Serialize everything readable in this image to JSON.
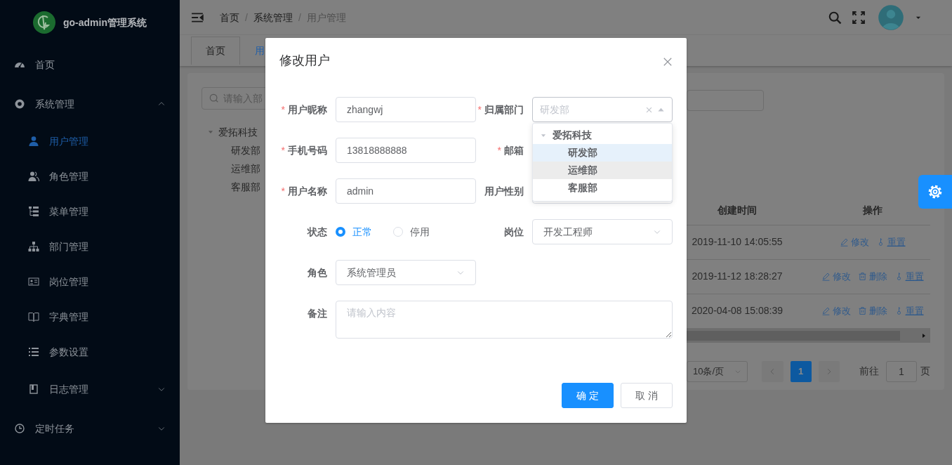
{
  "sidebar": {
    "logo_text": "go-admin管理系统",
    "items": [
      {
        "label": "首页",
        "selected": false
      },
      {
        "label": "系统管理",
        "selected": false,
        "expanded": true,
        "children": [
          {
            "label": "用户管理",
            "selected": true
          },
          {
            "label": "角色管理",
            "selected": false
          },
          {
            "label": "菜单管理",
            "selected": false
          },
          {
            "label": "部门管理",
            "selected": false
          },
          {
            "label": "岗位管理",
            "selected": false
          },
          {
            "label": "字典管理",
            "selected": false
          },
          {
            "label": "参数设置",
            "selected": false
          },
          {
            "label": "日志管理",
            "selected": false,
            "expanded": false
          }
        ]
      },
      {
        "label": "定时任务",
        "selected": false,
        "expanded": false
      }
    ]
  },
  "breadcrumb": [
    {
      "label": "首页",
      "current": false
    },
    {
      "separator": "/",
      "label": "系统管理",
      "current": false
    },
    {
      "separator": "/",
      "label": "用户管理",
      "current": true
    }
  ],
  "tabs": [
    {
      "label": "首页",
      "selected": false
    },
    {
      "label": "用",
      "selected": true
    }
  ],
  "dept_panel": {
    "search_placeholder": "请输入部",
    "tree": [
      {
        "label": "爱拓科技",
        "expanded": true,
        "children": [
          {
            "label": "研发部"
          },
          {
            "label": "运维部"
          },
          {
            "label": "客服部"
          }
        ]
      }
    ]
  },
  "table": {
    "columns": [
      "创建时间",
      "操作"
    ],
    "rows": [
      {
        "created": "2019-11-10 14:05:55",
        "actions": [
          {
            "kind": "edit",
            "label": "修改"
          },
          {
            "kind": "reset",
            "label": "重置"
          }
        ]
      },
      {
        "created": "2019-11-12 18:28:27",
        "actions": [
          {
            "kind": "edit",
            "label": "修改"
          },
          {
            "kind": "delete",
            "label": "删除"
          },
          {
            "kind": "reset",
            "label": "重置"
          }
        ]
      },
      {
        "created": "2020-04-08 15:08:39",
        "actions": [
          {
            "kind": "edit",
            "label": "修改"
          },
          {
            "kind": "delete",
            "label": "删除"
          },
          {
            "kind": "reset",
            "label": "重置"
          }
        ]
      }
    ]
  },
  "pagination": {
    "page_size": "10条/页",
    "pages": [
      {
        "label": "1",
        "selected": true
      }
    ],
    "goto_label": "前往",
    "goto_value": "1",
    "goto_suffix": "页"
  },
  "modal": {
    "title": "修改用户",
    "rows": [
      {
        "left": {
          "label": "用户昵称",
          "required_mark": "*",
          "kind": "text",
          "value": "zhangwj"
        },
        "right": {
          "label": "归属部门",
          "required_mark": "*",
          "kind": "tree-select",
          "placeholder": "研发部"
        }
      },
      {
        "left": {
          "label": "手机号码",
          "required_mark": "*",
          "kind": "text",
          "value": "13818888888"
        },
        "right": {
          "label": "邮箱",
          "required_mark": "*"
        }
      },
      {
        "left": {
          "label": "用户名称",
          "required_mark": "*",
          "kind": "text",
          "value": "admin"
        },
        "right": {
          "label": "用户性别",
          "kind": "select"
        }
      },
      {
        "left": {
          "label": "状态",
          "kind": "radio",
          "options": [
            {
              "label": "正常",
              "selected": true
            },
            {
              "label": "停用",
              "selected": false
            }
          ]
        },
        "right": {
          "label": "岗位",
          "kind": "select",
          "value": "开发工程师"
        }
      },
      {
        "left": {
          "label": "角色",
          "kind": "select",
          "value": "系统管理员"
        }
      },
      {
        "full": {
          "label": "备注",
          "kind": "textarea",
          "placeholder": "请输入内容"
        }
      }
    ],
    "dropdown": [
      {
        "label": "爱拓科技",
        "expanded": true,
        "selected": false,
        "hovered": false,
        "children": [
          {
            "label": "研发部",
            "selected": true,
            "hovered": false
          },
          {
            "label": "运维部",
            "selected": false,
            "hovered": true
          },
          {
            "label": "客服部",
            "selected": false,
            "hovered": false
          }
        ]
      }
    ],
    "buttons": [
      {
        "label": "确 定",
        "kind": "primary"
      },
      {
        "label": "取 消",
        "kind": "default"
      }
    ]
  }
}
